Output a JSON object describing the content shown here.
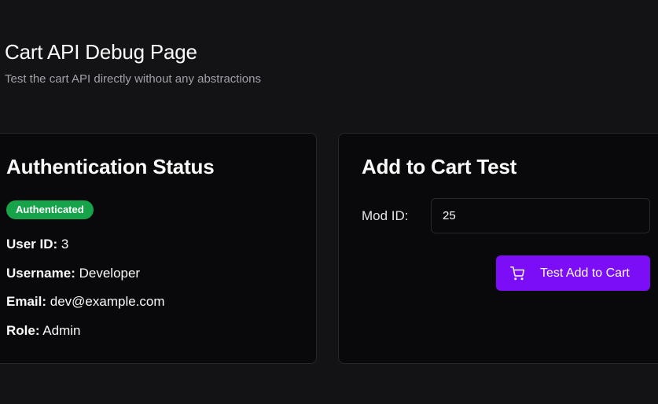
{
  "header": {
    "title": "Cart API Debug Page",
    "subtitle": "Test the cart API directly without any abstractions"
  },
  "auth_card": {
    "title": "Authentication Status",
    "badge": "Authenticated",
    "user_id_label": "User ID:",
    "user_id": "3",
    "username_label": "Username:",
    "username": "Developer",
    "email_label": "Email:",
    "email": "dev@example.com",
    "role_label": "Role:",
    "role": "Admin"
  },
  "cart_card": {
    "title": "Add to Cart Test",
    "mod_id_label": "Mod ID:",
    "mod_id_value": "25",
    "button_label": "Test Add to Cart",
    "button_icon": "shopping-cart-icon"
  },
  "colors": {
    "background": "#131315",
    "card": "#09090b",
    "badge_green": "#16a34a",
    "accent_purple": "#7c0ef7"
  }
}
